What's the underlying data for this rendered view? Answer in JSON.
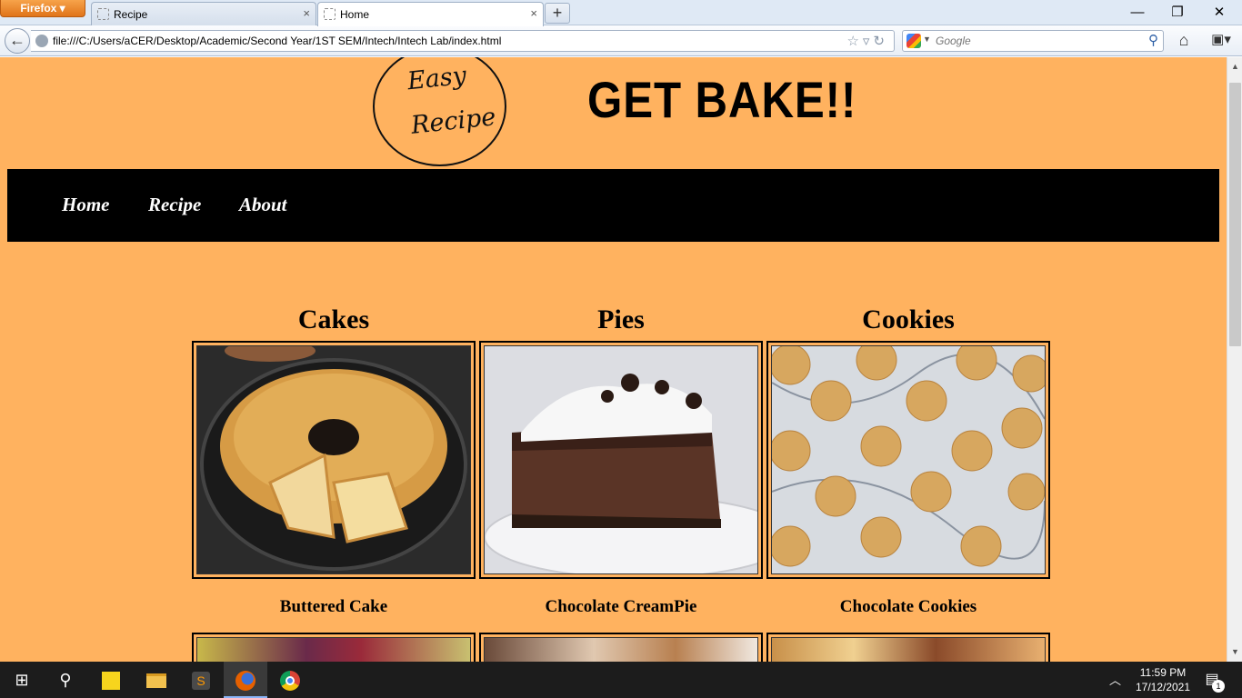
{
  "browser": {
    "menu_button": "Firefox",
    "tabs": [
      {
        "label": "Recipe",
        "close": "×"
      },
      {
        "label": "Home",
        "close": "×"
      }
    ],
    "new_tab": "+",
    "window_controls": {
      "minimize": "—",
      "restore": "❐",
      "close": "✕"
    },
    "url": "file:///C:/Users/aCER/Desktop/Academic/Second Year/1ST SEM/Intech/Intech Lab/index.html",
    "search_placeholder": "Google"
  },
  "page": {
    "logo": {
      "line1": "Easy",
      "line2": "Recipe"
    },
    "title": "GET BAKE!!",
    "nav": [
      "Home",
      "Recipe",
      "About"
    ],
    "categories": [
      {
        "title": "Cakes",
        "item": "Buttered Cake"
      },
      {
        "title": "Pies",
        "item": "Chocolate CreamPie"
      },
      {
        "title": "Cookies",
        "item": "Chocolate Cookies"
      }
    ]
  },
  "taskbar": {
    "time": "11:59 PM",
    "date": "17/12/2021",
    "notification_count": "1"
  },
  "icons": [
    "windows-start-icon",
    "search-icon",
    "sticky-notes-icon",
    "file-explorer-icon",
    "sublime-text-icon",
    "firefox-icon",
    "chrome-icon",
    "home-icon",
    "bookmarks-icon",
    "back-arrow-icon",
    "reload-icon",
    "star-icon"
  ]
}
